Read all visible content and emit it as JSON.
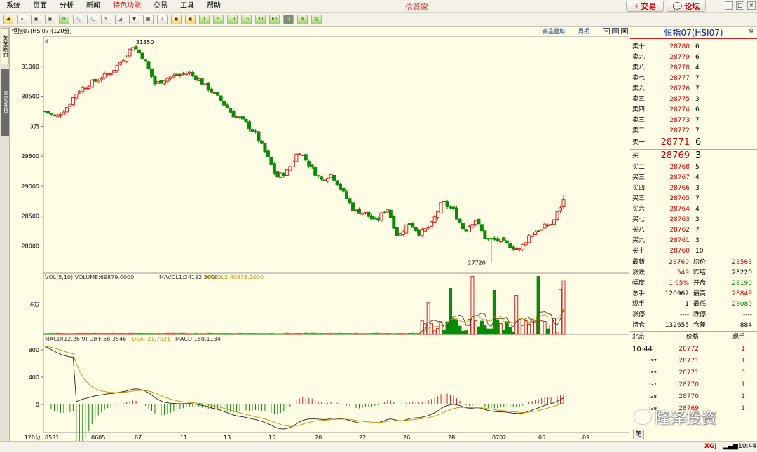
{
  "menu": [
    "系统",
    "页面",
    "分析",
    "新闻",
    "特色功能",
    "交易",
    "工具",
    "帮助"
  ],
  "app_title": "信管家",
  "buttons": {
    "trade": "交易",
    "forum": "论坛"
  },
  "toolbar": [
    "◀",
    "⌂",
    "▣",
    "▣",
    "⟳",
    "🔍",
    "🔍",
    "✎",
    "◢",
    "▼",
    "▦",
    "↗",
    "▣",
    "▣",
    "1",
    "5",
    "10",
    "15",
    "30",
    "60",
    "日",
    "周",
    "月"
  ],
  "left_tabs": [
    "黄金原油",
    "国际期货"
  ],
  "chart": {
    "header": "恒指07(HSI07)(120分)",
    "links": [
      "商品叠加",
      "周期"
    ],
    "k_label": "K",
    "price_ticks": [
      {
        "label": "31000",
        "v": 31000
      },
      {
        "label": "30500",
        "v": 30500
      },
      {
        "label": "3万",
        "v": 30000
      },
      {
        "label": "29500",
        "v": 29500
      },
      {
        "label": "29000",
        "v": 29000
      },
      {
        "label": "28500",
        "v": 28500
      },
      {
        "label": "28000",
        "v": 28000
      }
    ],
    "high_label": "31350",
    "low_label": "27720",
    "vol_header": {
      "a": "VOL(5,10)",
      "b": "VOLUME:69879.0000",
      "c": "MAVOL1:24192.2000",
      "d": "MAVOL2:40876.2000"
    },
    "vol_tick": "6万",
    "macd_header": {
      "a": "MACD(12,26,9)",
      "b": "DIFF:58.3546",
      "c": "DEA:-21.7021",
      "d": "MACD:160.1134"
    },
    "macd_ticks": [
      {
        "label": "800",
        "v": 800
      },
      {
        "label": "400",
        "v": 400
      },
      {
        "label": "0",
        "v": 0
      }
    ],
    "period_label": "120分",
    "date_labels": [
      "0531",
      "0605",
      "07",
      "11",
      "13",
      "15",
      "20",
      "22",
      "26",
      "28",
      "0702",
      "05",
      "09"
    ]
  },
  "chart_data": {
    "type": "candlestick",
    "title": "恒指07(HSI07)",
    "period": "120分",
    "ylim": [
      27720,
      31350
    ],
    "closes": [
      30250,
      30150,
      30320,
      30590,
      30700,
      30800,
      30900,
      31100,
      31350,
      31120,
      30700,
      30800,
      30850,
      30900,
      30770,
      30600,
      30420,
      30200,
      30080,
      29900,
      29550,
      29150,
      29250,
      29600,
      29350,
      29100,
      29200,
      28900,
      28600,
      28550,
      28400,
      28650,
      28150,
      28400,
      28200,
      28350,
      28730,
      28600,
      28250,
      28450,
      28100,
      28100,
      28020,
      27930,
      28200,
      28300,
      28380,
      28769
    ],
    "high": 31350,
    "low": 27720,
    "volume_last": 69879,
    "mavol1": 24192.2,
    "mavol2": 40876.2,
    "macd": {
      "diff": 58.3546,
      "dea": -21.7021,
      "macd": 160.1134
    }
  },
  "quote": {
    "title": "恒指07(HSI07)",
    "asks": [
      {
        "label": "卖十",
        "price": "28780",
        "vol": "6"
      },
      {
        "label": "卖九",
        "price": "28779",
        "vol": "6"
      },
      {
        "label": "卖八",
        "price": "28778",
        "vol": "4"
      },
      {
        "label": "卖七",
        "price": "28777",
        "vol": "7"
      },
      {
        "label": "卖六",
        "price": "28776",
        "vol": "7"
      },
      {
        "label": "卖五",
        "price": "28775",
        "vol": "3"
      },
      {
        "label": "卖四",
        "price": "28774",
        "vol": "6"
      },
      {
        "label": "卖三",
        "price": "28773",
        "vol": "7"
      },
      {
        "label": "卖二",
        "price": "28772",
        "vol": "7"
      },
      {
        "label": "卖一",
        "price": "28771",
        "vol": "6"
      }
    ],
    "bids": [
      {
        "label": "买一",
        "price": "28769",
        "vol": "3"
      },
      {
        "label": "买二",
        "price": "28768",
        "vol": "5"
      },
      {
        "label": "买三",
        "price": "28767",
        "vol": "4"
      },
      {
        "label": "买四",
        "price": "28766",
        "vol": "3"
      },
      {
        "label": "买五",
        "price": "28765",
        "vol": "7"
      },
      {
        "label": "买六",
        "price": "28764",
        "vol": "4"
      },
      {
        "label": "买七",
        "price": "28763",
        "vol": "3"
      },
      {
        "label": "买八",
        "price": "28762",
        "vol": "7"
      },
      {
        "label": "买九",
        "price": "28761",
        "vol": "3"
      },
      {
        "label": "买十",
        "price": "28760",
        "vol": "10"
      }
    ],
    "stats": [
      {
        "l1": "最新",
        "v1": "28769",
        "l2": "均价",
        "v2": "28563",
        "c1": "red",
        "c2": "red"
      },
      {
        "l1": "涨跌",
        "v1": "549",
        "l2": "昨结",
        "v2": "28220",
        "c1": "red",
        "c2": ""
      },
      {
        "l1": "幅度",
        "v1": "1.95%",
        "l2": "开盘",
        "v2": "28190",
        "c1": "red",
        "c2": "green"
      },
      {
        "l1": "总手",
        "v1": "120962",
        "l2": "最高",
        "v2": "28849",
        "c1": "",
        "c2": "red"
      },
      {
        "l1": "现手",
        "v1": "1",
        "l2": "最低",
        "v2": "28089",
        "c1": "",
        "c2": "green"
      },
      {
        "l1": "涨停",
        "v1": "----",
        "l2": "跌停",
        "v2": "----",
        "c1": "",
        "c2": ""
      },
      {
        "l1": "持仓",
        "v1": "132655",
        "l2": "仓差",
        "v2": "-884",
        "c1": "",
        "c2": ""
      }
    ],
    "tape_header": {
      "a": "北京",
      "b": "价格",
      "c": "现手"
    },
    "tape": [
      {
        "t": "10:44",
        "p": "28772",
        "v": "1"
      },
      {
        "t": ":37",
        "p": "28771",
        "v": "1"
      },
      {
        "t": ":37",
        "p": "28771",
        "v": "3"
      },
      {
        "t": ":37",
        "p": "28770",
        "v": "1"
      },
      {
        "t": ":38",
        "p": "28770",
        "v": "1"
      },
      {
        "t": ":39",
        "p": "28769",
        "v": "1"
      }
    ],
    "tab_label": "笔"
  },
  "status": {
    "brand": "XGJ",
    "time": "10:44"
  },
  "watermark": "隆泽投资"
}
